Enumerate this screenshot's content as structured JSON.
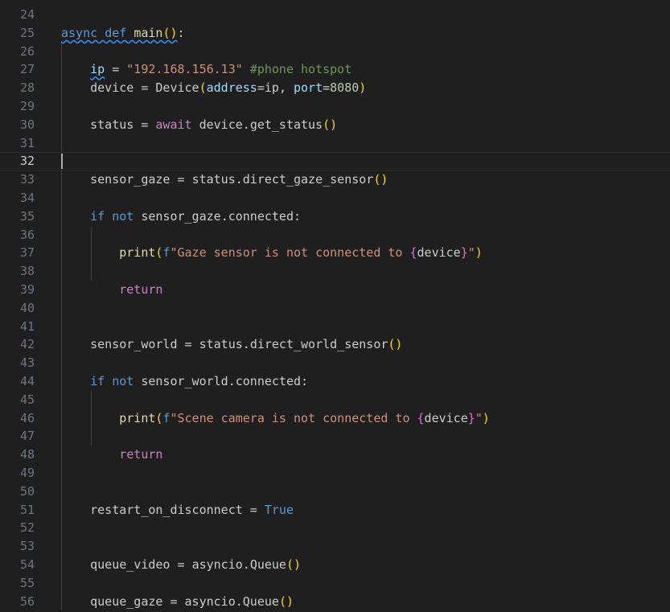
{
  "editor": {
    "language": "python",
    "current_line": "32",
    "colors": {
      "background": "#1f1f1f",
      "line_number": "#6e7681",
      "keyword": "#569cd6",
      "control_keyword": "#c586c0",
      "function": "#dcdcaa",
      "variable": "#9cdcfe",
      "string": "#ce9178",
      "number": "#b5cea8",
      "comment": "#6a9955",
      "class": "#4ec9b0",
      "bracket_level1": "#ffd700",
      "bracket_level2": "#da70d6"
    },
    "lines": [
      {
        "n": "24",
        "tokens": []
      },
      {
        "n": "25",
        "tokens": [
          {
            "t": "async",
            "c": "kw-blue squig"
          },
          {
            "t": " ",
            "c": "pl squig"
          },
          {
            "t": "def",
            "c": "kw-blue squig"
          },
          {
            "t": " ",
            "c": "pl squig"
          },
          {
            "t": "main",
            "c": "fn squig"
          },
          {
            "t": "()",
            "c": "br1 squig"
          },
          {
            "t": ":",
            "c": "pl"
          }
        ]
      },
      {
        "n": "26",
        "tokens": []
      },
      {
        "n": "27",
        "tokens": [
          {
            "t": "    ",
            "c": "pl"
          },
          {
            "t": "ip",
            "c": "var squig"
          },
          {
            "t": " = ",
            "c": "pl"
          },
          {
            "t": "\"192.168.156.13\"",
            "c": "str"
          },
          {
            "t": " ",
            "c": "pl"
          },
          {
            "t": "#phone hotspot",
            "c": "cm"
          }
        ]
      },
      {
        "n": "28",
        "tokens": [
          {
            "t": "    ",
            "c": "pl"
          },
          {
            "t": "device",
            "c": "pl"
          },
          {
            "t": " = ",
            "c": "pl"
          },
          {
            "t": "Device",
            "c": "pl"
          },
          {
            "t": "(",
            "c": "br1"
          },
          {
            "t": "address",
            "c": "var"
          },
          {
            "t": "=",
            "c": "pl"
          },
          {
            "t": "ip",
            "c": "pl"
          },
          {
            "t": ", ",
            "c": "pl"
          },
          {
            "t": "port",
            "c": "var"
          },
          {
            "t": "=",
            "c": "pl"
          },
          {
            "t": "8080",
            "c": "num"
          },
          {
            "t": ")",
            "c": "br1"
          }
        ]
      },
      {
        "n": "29",
        "tokens": []
      },
      {
        "n": "30",
        "tokens": [
          {
            "t": "    ",
            "c": "pl"
          },
          {
            "t": "status",
            "c": "pl"
          },
          {
            "t": " = ",
            "c": "pl"
          },
          {
            "t": "await",
            "c": "kw-ctrl"
          },
          {
            "t": " ",
            "c": "pl"
          },
          {
            "t": "device",
            "c": "pl"
          },
          {
            "t": ".",
            "c": "pl"
          },
          {
            "t": "get_status",
            "c": "pl"
          },
          {
            "t": "()",
            "c": "br1"
          }
        ]
      },
      {
        "n": "31",
        "tokens": []
      },
      {
        "n": "32",
        "tokens": []
      },
      {
        "n": "33",
        "tokens": [
          {
            "t": "    ",
            "c": "pl"
          },
          {
            "t": "sensor_gaze",
            "c": "pl"
          },
          {
            "t": " = ",
            "c": "pl"
          },
          {
            "t": "status",
            "c": "pl"
          },
          {
            "t": ".",
            "c": "pl"
          },
          {
            "t": "direct_gaze_sensor",
            "c": "pl"
          },
          {
            "t": "()",
            "c": "br1"
          }
        ]
      },
      {
        "n": "34",
        "tokens": []
      },
      {
        "n": "35",
        "tokens": [
          {
            "t": "    ",
            "c": "pl"
          },
          {
            "t": "if",
            "c": "kw-blue"
          },
          {
            "t": " ",
            "c": "pl"
          },
          {
            "t": "not",
            "c": "kw-blue"
          },
          {
            "t": " ",
            "c": "pl"
          },
          {
            "t": "sensor_gaze",
            "c": "pl"
          },
          {
            "t": ".",
            "c": "pl"
          },
          {
            "t": "connected",
            "c": "pl"
          },
          {
            "t": ":",
            "c": "pl"
          }
        ]
      },
      {
        "n": "36",
        "tokens": []
      },
      {
        "n": "37",
        "tokens": [
          {
            "t": "        ",
            "c": "pl"
          },
          {
            "t": "print",
            "c": "fn"
          },
          {
            "t": "(",
            "c": "br1"
          },
          {
            "t": "f",
            "c": "kw-blue"
          },
          {
            "t": "\"Gaze sensor is not connected to ",
            "c": "str"
          },
          {
            "t": "{",
            "c": "br2"
          },
          {
            "t": "device",
            "c": "pl"
          },
          {
            "t": "}",
            "c": "br2"
          },
          {
            "t": "\"",
            "c": "str"
          },
          {
            "t": ")",
            "c": "br1"
          }
        ]
      },
      {
        "n": "38",
        "tokens": []
      },
      {
        "n": "39",
        "tokens": [
          {
            "t": "        ",
            "c": "pl"
          },
          {
            "t": "return",
            "c": "kw-ctrl"
          }
        ]
      },
      {
        "n": "40",
        "tokens": []
      },
      {
        "n": "41",
        "tokens": []
      },
      {
        "n": "42",
        "tokens": [
          {
            "t": "    ",
            "c": "pl"
          },
          {
            "t": "sensor_world",
            "c": "pl"
          },
          {
            "t": " = ",
            "c": "pl"
          },
          {
            "t": "status",
            "c": "pl"
          },
          {
            "t": ".",
            "c": "pl"
          },
          {
            "t": "direct_world_sensor",
            "c": "pl"
          },
          {
            "t": "()",
            "c": "br1"
          }
        ]
      },
      {
        "n": "43",
        "tokens": []
      },
      {
        "n": "44",
        "tokens": [
          {
            "t": "    ",
            "c": "pl"
          },
          {
            "t": "if",
            "c": "kw-blue"
          },
          {
            "t": " ",
            "c": "pl"
          },
          {
            "t": "not",
            "c": "kw-blue"
          },
          {
            "t": " ",
            "c": "pl"
          },
          {
            "t": "sensor_world",
            "c": "pl"
          },
          {
            "t": ".",
            "c": "pl"
          },
          {
            "t": "connected",
            "c": "pl"
          },
          {
            "t": ":",
            "c": "pl"
          }
        ]
      },
      {
        "n": "45",
        "tokens": []
      },
      {
        "n": "46",
        "tokens": [
          {
            "t": "        ",
            "c": "pl"
          },
          {
            "t": "print",
            "c": "fn"
          },
          {
            "t": "(",
            "c": "br1"
          },
          {
            "t": "f",
            "c": "kw-blue"
          },
          {
            "t": "\"Scene camera is not connected to ",
            "c": "str"
          },
          {
            "t": "{",
            "c": "br2"
          },
          {
            "t": "device",
            "c": "pl"
          },
          {
            "t": "}",
            "c": "br2"
          },
          {
            "t": "\"",
            "c": "str"
          },
          {
            "t": ")",
            "c": "br1"
          }
        ]
      },
      {
        "n": "47",
        "tokens": []
      },
      {
        "n": "48",
        "tokens": [
          {
            "t": "        ",
            "c": "pl"
          },
          {
            "t": "return",
            "c": "kw-ctrl"
          }
        ]
      },
      {
        "n": "49",
        "tokens": []
      },
      {
        "n": "50",
        "tokens": []
      },
      {
        "n": "51",
        "tokens": [
          {
            "t": "    ",
            "c": "pl"
          },
          {
            "t": "restart_on_disconnect",
            "c": "pl"
          },
          {
            "t": " = ",
            "c": "pl"
          },
          {
            "t": "True",
            "c": "kw-blue"
          }
        ]
      },
      {
        "n": "52",
        "tokens": []
      },
      {
        "n": "53",
        "tokens": []
      },
      {
        "n": "54",
        "tokens": [
          {
            "t": "    ",
            "c": "pl"
          },
          {
            "t": "queue_video",
            "c": "pl"
          },
          {
            "t": " = ",
            "c": "pl"
          },
          {
            "t": "asyncio",
            "c": "pl"
          },
          {
            "t": ".",
            "c": "pl"
          },
          {
            "t": "Queue",
            "c": "pl"
          },
          {
            "t": "()",
            "c": "br1"
          }
        ]
      },
      {
        "n": "55",
        "tokens": []
      },
      {
        "n": "56",
        "tokens": [
          {
            "t": "    ",
            "c": "pl"
          },
          {
            "t": "queue_gaze",
            "c": "pl"
          },
          {
            "t": " = ",
            "c": "pl"
          },
          {
            "t": "asyncio",
            "c": "pl"
          },
          {
            "t": ".",
            "c": "pl"
          },
          {
            "t": "Queue",
            "c": "pl"
          },
          {
            "t": "()",
            "c": "br1"
          }
        ]
      }
    ]
  }
}
